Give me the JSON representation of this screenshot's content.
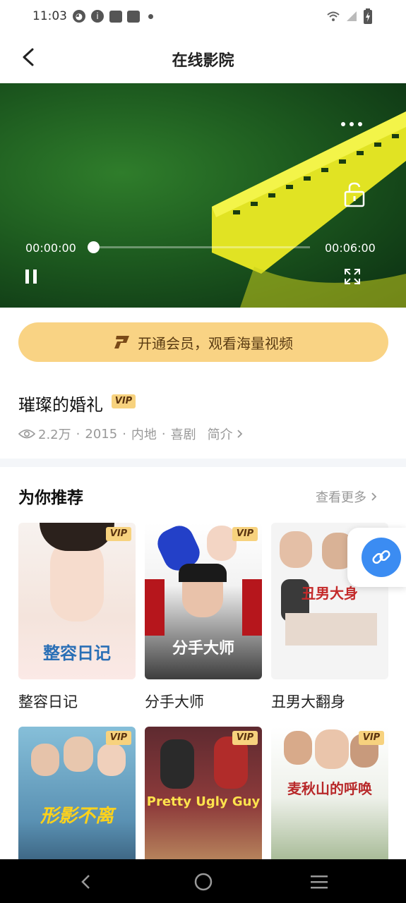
{
  "status_bar": {
    "time": "11:03"
  },
  "header": {
    "title": "在线影院"
  },
  "player": {
    "current_time": "00:00:00",
    "total_time": "00:06:00",
    "progress": 0
  },
  "vip_banner": {
    "text": "开通会员，观看海量视频"
  },
  "movie": {
    "title": "璀璨的婚礼",
    "badge": "VIP",
    "views": "2.2万",
    "year": "2015",
    "region": "内地",
    "genre": "喜剧",
    "intro_label": "简介"
  },
  "recommend": {
    "title": "为你推荐",
    "more_label": "查看更多",
    "badge": "VIP",
    "items": [
      {
        "title": "整容日记",
        "poster_text": "整容日记"
      },
      {
        "title": "分手大师",
        "poster_text": "分手大师"
      },
      {
        "title": "丑男大翻身",
        "poster_text": "丑男大身"
      },
      {
        "title": "",
        "poster_text": "形影不离"
      },
      {
        "title": "",
        "poster_text": "Pretty Ugly Guy"
      },
      {
        "title": "",
        "poster_text": "麦秋山的呼唤"
      }
    ]
  },
  "colors": {
    "accent": "#f9d384",
    "link_button": "#3b8cf2"
  }
}
